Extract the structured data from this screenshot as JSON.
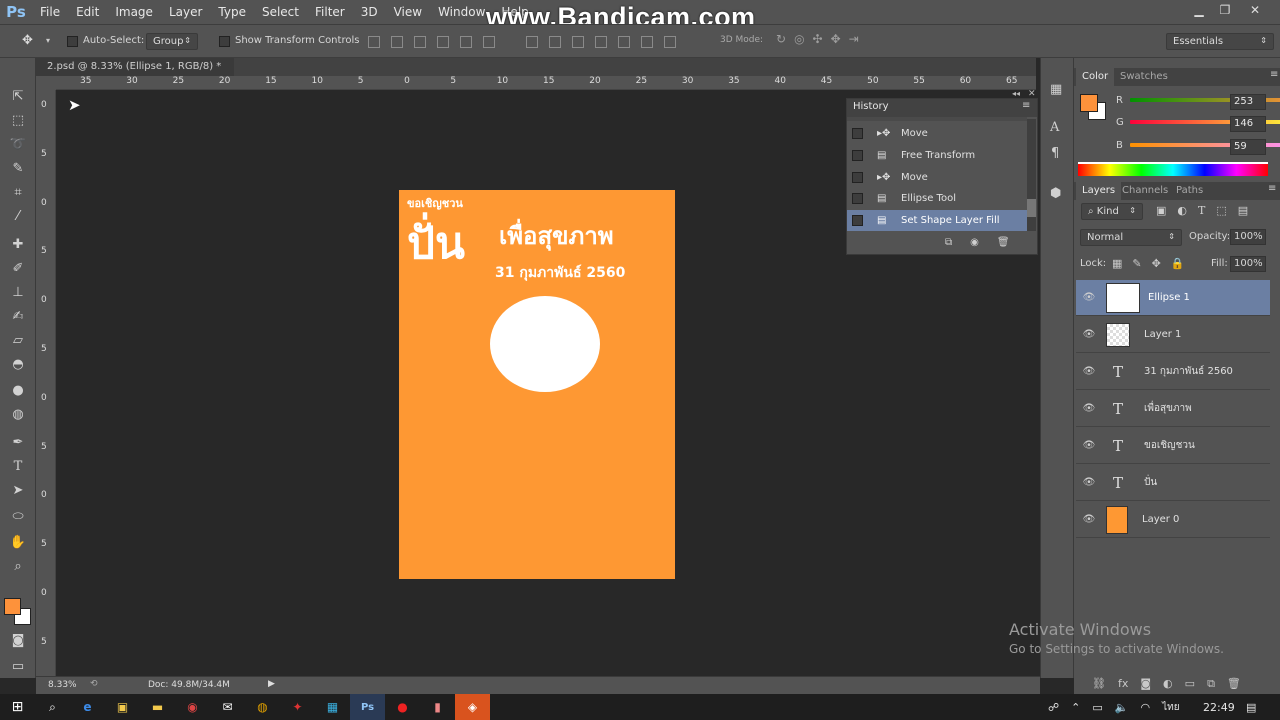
{
  "menubar": {
    "logo": "Ps",
    "items": [
      "File",
      "Edit",
      "Image",
      "Layer",
      "Type",
      "Select",
      "Filter",
      "3D",
      "View",
      "Window",
      "Help"
    ],
    "watermark": "www.Bandicam.com"
  },
  "options": {
    "auto_select_label": "Auto-Select:",
    "auto_select_value": "Group",
    "transform_label": "Show Transform Controls",
    "mode_3d_label": "3D Mode:",
    "workspace": "Essentials"
  },
  "document": {
    "tab_title": "2.psd @ 8.33% (Ellipse 1, RGB/8) *",
    "close": "×",
    "ruler_top_labels": [
      "35",
      "30",
      "25",
      "20",
      "15",
      "10",
      "5",
      "0",
      "5",
      "10",
      "15",
      "20",
      "25",
      "30",
      "35",
      "40",
      "45",
      "50",
      "55",
      "60",
      "65"
    ],
    "ruler_left_labels": [
      "0",
      "5",
      "0",
      "5",
      "0",
      "5",
      "0",
      "5",
      "0",
      "5",
      "0",
      "5"
    ]
  },
  "artwork": {
    "small_text": "ขอเชิญชวน",
    "big_text": "ปั่น",
    "title_text": "เพื่อสุขภาพ",
    "date_text": "31 กุมภาพันธ์ 2560",
    "bg_color": "#fe9833"
  },
  "history": {
    "title": "History",
    "items": [
      "Move",
      "Free Transform",
      "Move",
      "Ellipse Tool",
      "Set Shape Layer Fill"
    ]
  },
  "color": {
    "tabs": [
      "Color",
      "Swatches"
    ],
    "r_label": "R",
    "r": "253",
    "g_label": "G",
    "g": "146",
    "b_label": "B",
    "b": "59",
    "fg": "#fd923b"
  },
  "layers": {
    "tabs": [
      "Layers",
      "Channels",
      "Paths"
    ],
    "kind": "Kind",
    "blend_mode": "Normal",
    "opacity_label": "Opacity:",
    "opacity": "100%",
    "lock_label": "Lock:",
    "fill_label": "Fill:",
    "fill": "100%",
    "items": [
      {
        "name": "Ellipse 1"
      },
      {
        "name": "Layer 1"
      },
      {
        "name": "31 กุมภาพันธ์ 2560"
      },
      {
        "name": "เพื่อสุขภาพ"
      },
      {
        "name": "ขอเชิญชวน"
      },
      {
        "name": "ปั่น"
      },
      {
        "name": "Layer 0"
      }
    ]
  },
  "status": {
    "zoom": "8.33%",
    "doc": "Doc: 49.8M/34.4M"
  },
  "activate": {
    "line1": "Activate Windows",
    "line2": "Go to Settings to activate Windows."
  },
  "taskbar": {
    "time": "22:49",
    "lang": "ไทย"
  }
}
